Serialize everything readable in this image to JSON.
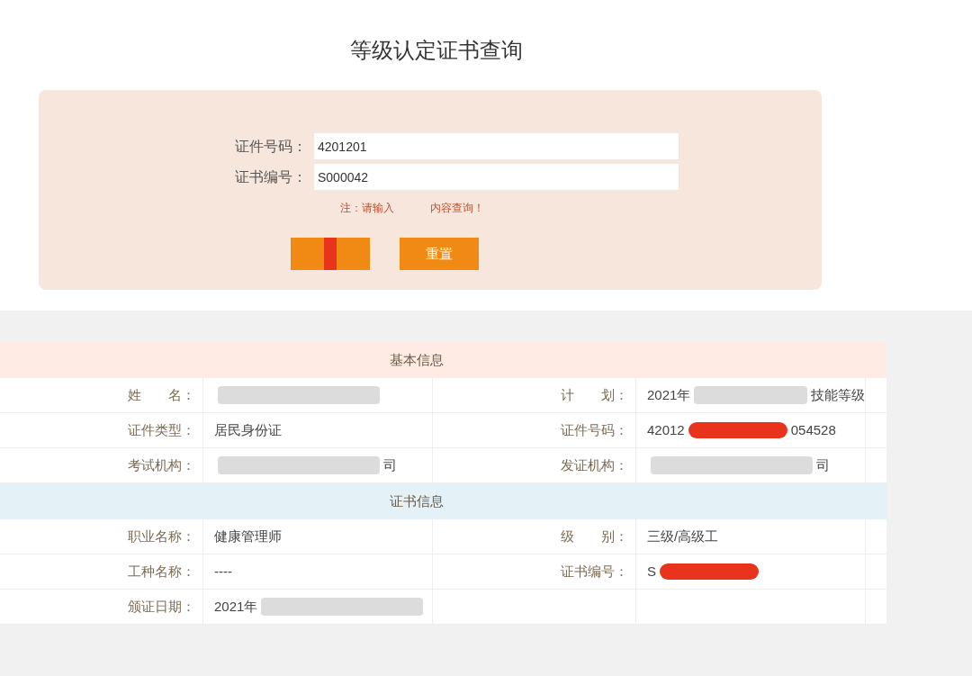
{
  "title": "等级认定证书查询",
  "form": {
    "fields": [
      {
        "label": "证件号码：",
        "value": "4201201"
      },
      {
        "label": "证书编号：",
        "value": "S000042"
      }
    ],
    "note_parts": [
      "注：请输入",
      "内容查询！"
    ],
    "buttons": [
      {
        "label": "重置"
      }
    ],
    "covered_button": true
  },
  "sections": [
    {
      "title": "基本信息",
      "color": "#fdebe4",
      "rows": [
        [
          {
            "label": "姓　　名：",
            "blurred": true
          },
          {
            "label": "计　　划：",
            "parts": [
              "2021年",
              "技能等级"
            ],
            "blurred": true
          }
        ],
        [
          {
            "label": "证件类型：",
            "parts": [
              "居民身份证"
            ]
          },
          {
            "label": "证件号码：",
            "parts": [
              "42012",
              "054528"
            ],
            "scribbled": true
          }
        ],
        [
          {
            "label": "考试机构：",
            "parts": [
              "司"
            ],
            "blurred_before": true
          },
          {
            "label": "发证机构：",
            "parts": [
              "司"
            ],
            "blurred_before": true
          }
        ]
      ]
    },
    {
      "title": "证书信息",
      "color": "#e4f2f7",
      "rows": [
        [
          {
            "label": "职业名称：",
            "parts": [
              "健康管理师"
            ]
          },
          {
            "label": "级　　别：",
            "parts": [
              "三级/高级工"
            ]
          }
        ],
        [
          {
            "label": "工种名称：",
            "parts": [
              "----"
            ]
          },
          {
            "label": "证书编号：",
            "parts": [
              "S"
            ],
            "scribbled": true
          }
        ],
        [
          {
            "label": "颁证日期：",
            "parts": [
              "2021年"
            ],
            "blurred": true
          },
          {}
        ]
      ]
    }
  ]
}
